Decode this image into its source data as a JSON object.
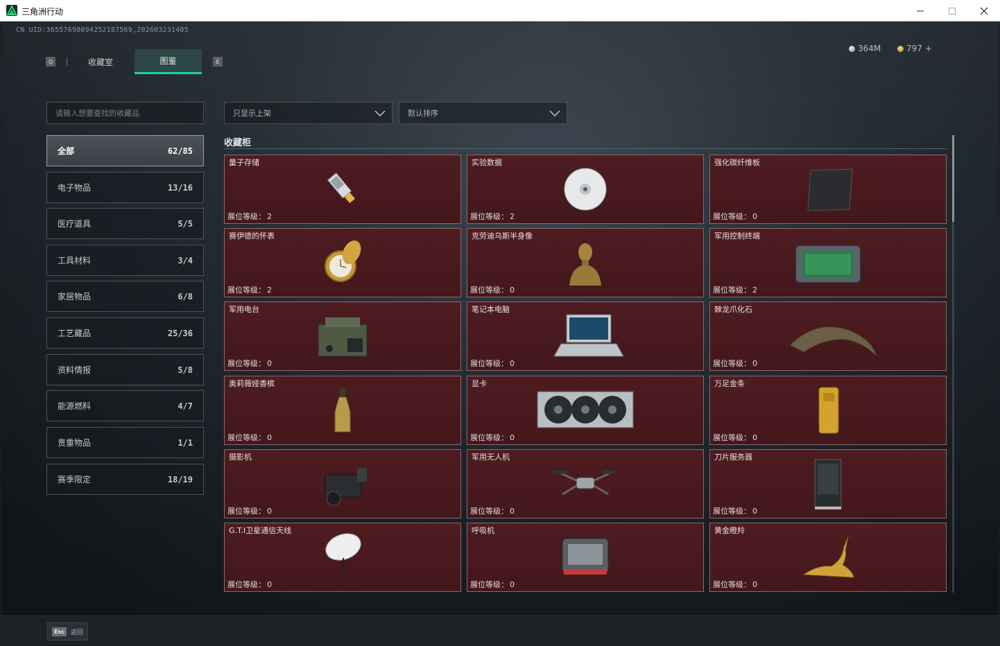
{
  "window": {
    "title": "三角洲行动",
    "minimize": "—",
    "maximize": "☐",
    "close": "✕"
  },
  "header": {
    "uid": "CN UID:3655769809425218​7569,202603231405",
    "key_left": "Q",
    "key_right": "E",
    "tabs": [
      {
        "label": "收藏室",
        "active": false
      },
      {
        "label": "图鉴",
        "active": true
      }
    ],
    "currency": [
      {
        "icon": "silver-coin-icon",
        "value": "364M"
      },
      {
        "icon": "gold-coin-icon",
        "value": "797 +"
      }
    ]
  },
  "search": {
    "placeholder": "请输入想要查找的收藏品"
  },
  "categories": [
    {
      "label": "全部",
      "count": "62/85",
      "active": true
    },
    {
      "label": "电子物品",
      "count": "13/16"
    },
    {
      "label": "医疗道具",
      "count": "5/5"
    },
    {
      "label": "工具材料",
      "count": "3/4"
    },
    {
      "label": "家居物品",
      "count": "6/8"
    },
    {
      "label": "工艺藏品",
      "count": "25/36"
    },
    {
      "label": "资料情报",
      "count": "5/8"
    },
    {
      "label": "能源燃料",
      "count": "4/7"
    },
    {
      "label": "贵重物品",
      "count": "1/1"
    },
    {
      "label": "赛季限定",
      "count": "18/19"
    }
  ],
  "filters": {
    "display": "只显示上架",
    "sort": "默认排序"
  },
  "section": {
    "title": "收藏柜"
  },
  "level_label": "展位等级：",
  "items": [
    {
      "name": "量子存储",
      "level": "2",
      "icon": "usb-drive-icon"
    },
    {
      "name": "实验数据",
      "level": "2",
      "icon": "disc-icon"
    },
    {
      "name": "强化碳纤维板",
      "level": "0",
      "icon": "carbon-plate-icon"
    },
    {
      "name": "赛伊德的怀表",
      "level": "2",
      "icon": "pocket-watch-icon"
    },
    {
      "name": "克劳迪乌斯半身像",
      "level": "0",
      "icon": "bust-icon"
    },
    {
      "name": "军用控制终端",
      "level": "2",
      "icon": "control-terminal-icon"
    },
    {
      "name": "军用电台",
      "level": "0",
      "icon": "radio-icon"
    },
    {
      "name": "笔记本电脑",
      "level": "0",
      "icon": "laptop-icon"
    },
    {
      "name": "棘龙爪化石",
      "level": "0",
      "icon": "claw-fossil-icon"
    },
    {
      "name": "奥莉薇娅香槟",
      "level": "0",
      "icon": "champagne-icon"
    },
    {
      "name": "显卡",
      "level": "0",
      "icon": "graphics-card-icon"
    },
    {
      "name": "万足金条",
      "level": "0",
      "icon": "gold-bar-icon"
    },
    {
      "name": "摄影机",
      "level": "0",
      "icon": "camera-icon"
    },
    {
      "name": "军用无人机",
      "level": "0",
      "icon": "drone-icon"
    },
    {
      "name": "刀片服务器",
      "level": "0",
      "icon": "server-icon"
    },
    {
      "name": "G.T.I卫星通信天线",
      "level": "0",
      "icon": "satellite-dish-icon"
    },
    {
      "name": "呼吸机",
      "level": "0",
      "icon": "ventilator-icon"
    },
    {
      "name": "黄金瞪羚",
      "level": "0",
      "icon": "gold-gazelle-icon"
    }
  ],
  "footer": {
    "esc_key": "Esc",
    "back_label": "返回"
  }
}
